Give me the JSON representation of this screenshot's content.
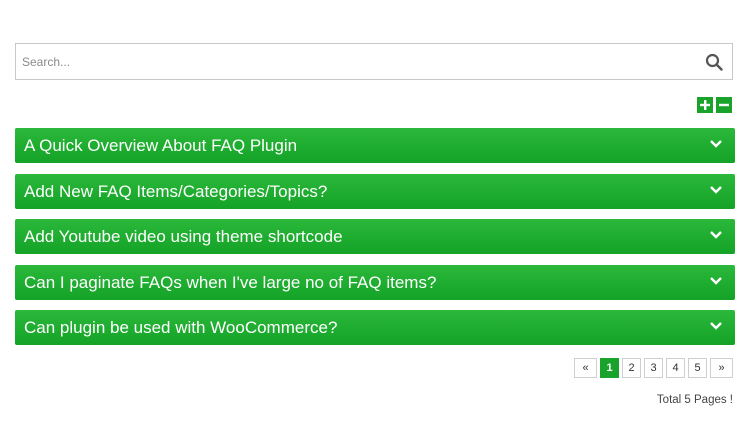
{
  "search": {
    "placeholder": "Search..."
  },
  "toggles": {
    "expand_icon": "plus-icon",
    "collapse_icon": "minus-icon"
  },
  "faq_items": [
    {
      "title": "A Quick Overview About FAQ Plugin"
    },
    {
      "title": "Add New FAQ Items/Categories/Topics?"
    },
    {
      "title": "Add Youtube video using theme shortcode"
    },
    {
      "title": "Can I paginate FAQs when I've large no of FAQ items?"
    },
    {
      "title": "Can plugin be used with WooCommerce?"
    }
  ],
  "pagination": {
    "prev": "«",
    "pages": [
      "1",
      "2",
      "3",
      "4",
      "5"
    ],
    "current": "1",
    "next": "»",
    "total": "Total 5 Pages !"
  },
  "colors": {
    "accent": "#1aa32a",
    "item_top": "#2bb83b",
    "item_bottom": "#14a327"
  }
}
